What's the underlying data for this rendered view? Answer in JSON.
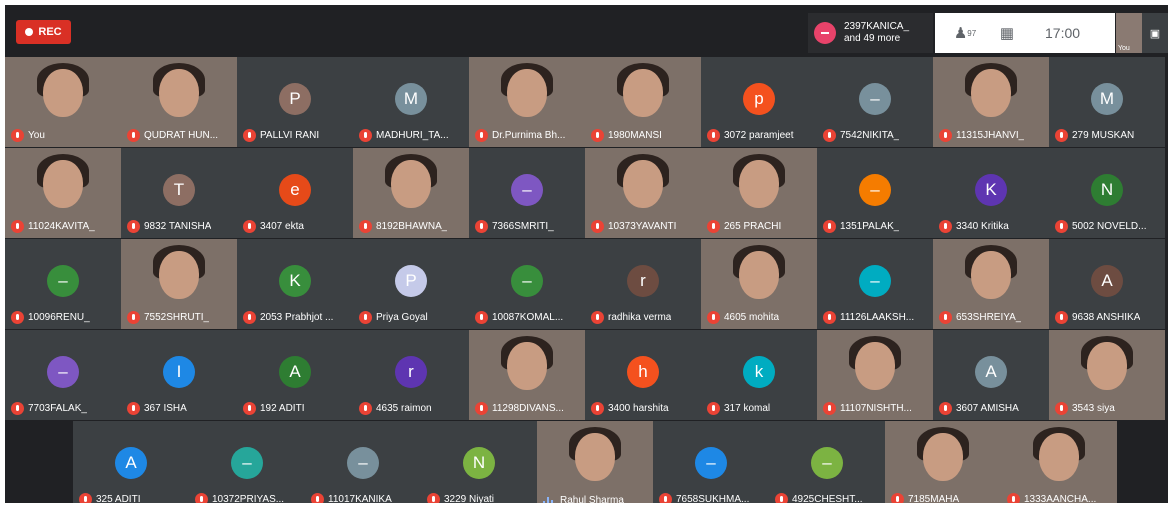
{
  "recording": {
    "label": "REC"
  },
  "participants_panel": {
    "line1": "2397KANICA_",
    "line2": "and 49 more"
  },
  "toolbar": {
    "participant_count": "97",
    "time": "17:00",
    "self_label": "You"
  },
  "rows": [
    [
      {
        "name": "You",
        "video": true
      },
      {
        "name": "QUDRAT HUN...",
        "video": true
      },
      {
        "name": "PALLVI RANI",
        "initial": "P",
        "color": "#8d6e63"
      },
      {
        "name": "MADHURI_TA...",
        "initial": "M",
        "color": "#78909c"
      },
      {
        "name": "Dr.Purnima Bh...",
        "video": true
      },
      {
        "name": "1980MANSI",
        "video": true
      },
      {
        "name": "3072 paramjeet",
        "initial": "p",
        "color": "#f4511e"
      },
      {
        "name": "7542NIKITA_",
        "initial": "–",
        "color": "#78909c"
      },
      {
        "name": "11315JHANVI_",
        "video": true
      },
      {
        "name": "279 MUSKAN",
        "initial": "M",
        "color": "#78909c"
      }
    ],
    [
      {
        "name": "11024KAVITA_",
        "video": true
      },
      {
        "name": "9832 TANISHA",
        "initial": "T",
        "color": "#8d6e63"
      },
      {
        "name": "3407 ekta",
        "initial": "e",
        "color": "#e64a19"
      },
      {
        "name": "8192BHAWNA_",
        "video": true
      },
      {
        "name": "7366SMRITI_",
        "initial": "–",
        "color": "#7e57c2"
      },
      {
        "name": "10373YAVANTI",
        "video": true
      },
      {
        "name": "265 PRACHI",
        "video": true
      },
      {
        "name": "1351PALAK_",
        "initial": "–",
        "color": "#f57c00"
      },
      {
        "name": "3340 Kritika",
        "initial": "K",
        "color": "#5e35b1"
      },
      {
        "name": "5002 NOVELD...",
        "initial": "N",
        "color": "#2e7d32"
      }
    ],
    [
      {
        "name": "10096RENU_",
        "initial": "–",
        "color": "#388e3c"
      },
      {
        "name": "7552SHRUTI_",
        "video": true
      },
      {
        "name": "2053 Prabhjot ...",
        "initial": "K",
        "color": "#388e3c"
      },
      {
        "name": "Priya Goyal",
        "initial": "P",
        "color": "#c5cae9"
      },
      {
        "name": "10087KOMAL...",
        "initial": "–",
        "color": "#388e3c"
      },
      {
        "name": "radhika verma",
        "initial": "r",
        "color": "#6d4c41"
      },
      {
        "name": "4605 mohita",
        "video": true
      },
      {
        "name": "11126LAAKSH...",
        "initial": "–",
        "color": "#00acc1"
      },
      {
        "name": "653SHREIYA_",
        "video": true
      },
      {
        "name": "9638 ANSHIKA",
        "initial": "A",
        "color": "#6d4c41"
      }
    ],
    [
      {
        "name": "7703FALAK_",
        "initial": "–",
        "color": "#7e57c2"
      },
      {
        "name": "367 ISHA",
        "initial": "I",
        "color": "#1e88e5"
      },
      {
        "name": "192 ADITI",
        "initial": "A",
        "color": "#2e7d32"
      },
      {
        "name": "4635 raimon",
        "initial": "r",
        "color": "#5e35b1"
      },
      {
        "name": "11298DIVANS...",
        "video": true
      },
      {
        "name": "3400 harshita",
        "initial": "h",
        "color": "#f4511e"
      },
      {
        "name": "317 komal",
        "initial": "k",
        "color": "#00acc1"
      },
      {
        "name": "11107NISHTH...",
        "video": true
      },
      {
        "name": "3607 AMISHA",
        "initial": "A",
        "color": "#78909c"
      },
      {
        "name": "3543 siya",
        "video": true
      }
    ],
    [
      {
        "name": "325 ADITI",
        "initial": "A",
        "color": "#1e88e5"
      },
      {
        "name": "10372PRIYAS...",
        "initial": "–",
        "color": "#26a69a"
      },
      {
        "name": "11017KANIKA_",
        "initial": "–",
        "color": "#78909c"
      },
      {
        "name": "3229 Niyati",
        "initial": "N",
        "color": "#7cb342"
      },
      {
        "name": "Rahul Sharma",
        "video": true,
        "speaking": true
      },
      {
        "name": "7658SUKHMA...",
        "initial": "–",
        "color": "#1e88e5"
      },
      {
        "name": "4925CHESHT...",
        "initial": "–",
        "color": "#7cb342"
      },
      {
        "name": "7185MAHA_",
        "video": true
      },
      {
        "name": "1333AANCHA...",
        "video": true
      }
    ]
  ]
}
